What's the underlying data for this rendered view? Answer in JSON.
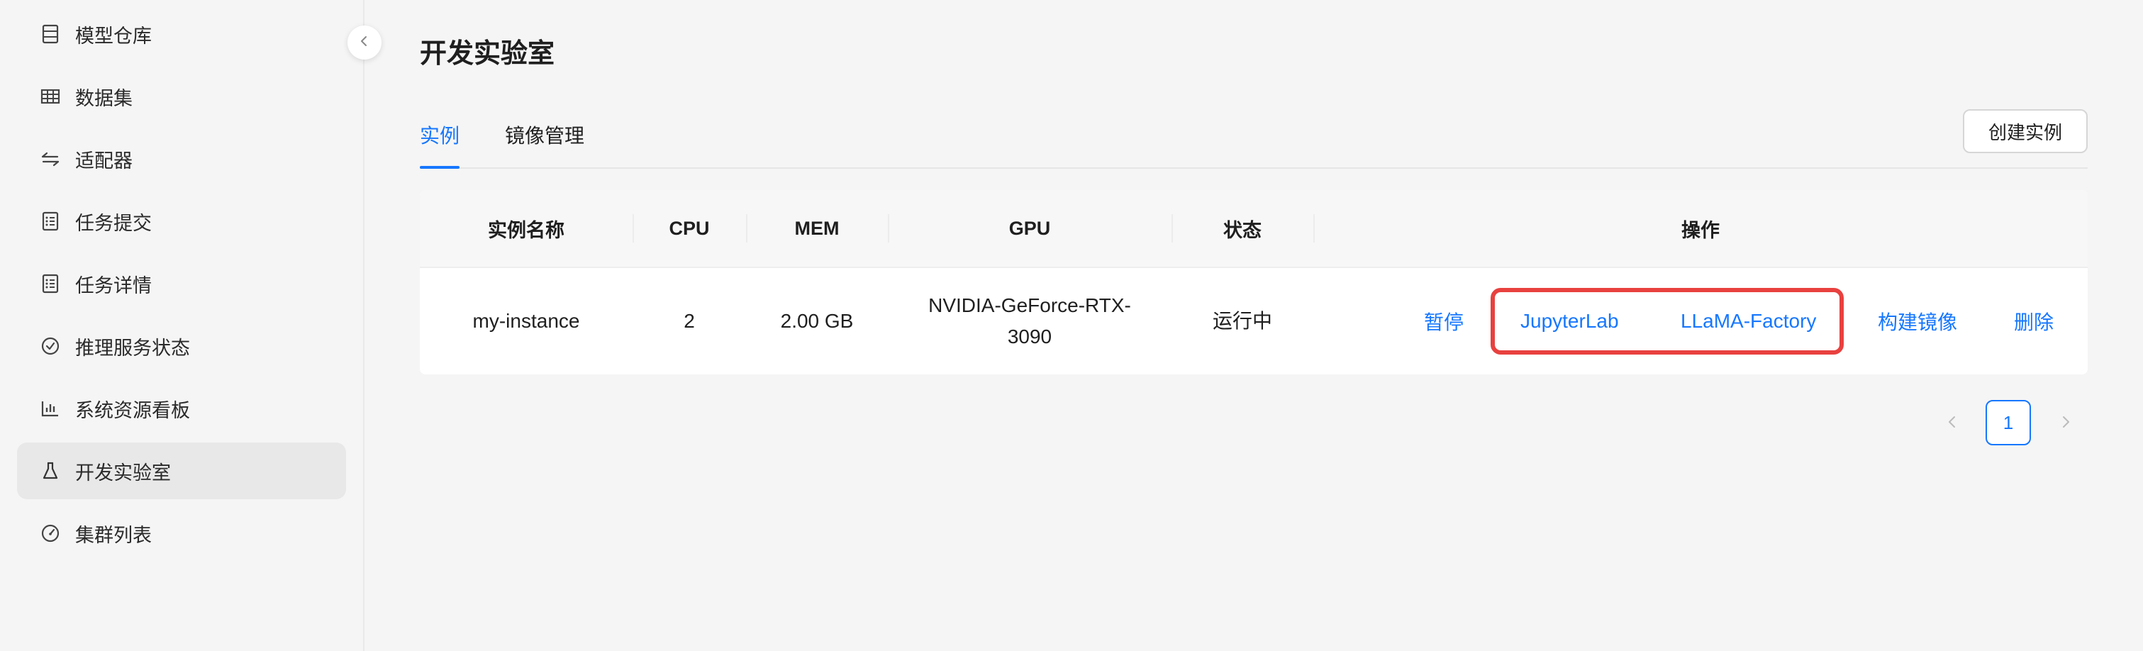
{
  "sidebar": {
    "items": [
      {
        "label": "模型仓库",
        "icon": "model-repo-icon"
      },
      {
        "label": "数据集",
        "icon": "table-grid-icon"
      },
      {
        "label": "适配器",
        "icon": "swap-arrows-icon"
      },
      {
        "label": "任务提交",
        "icon": "task-list-icon"
      },
      {
        "label": "任务详情",
        "icon": "task-detail-icon"
      },
      {
        "label": "推理服务状态",
        "icon": "check-circle-icon"
      },
      {
        "label": "系统资源看板",
        "icon": "bar-chart-icon"
      },
      {
        "label": "开发实验室",
        "icon": "flask-icon",
        "active": true
      },
      {
        "label": "集群列表",
        "icon": "dashboard-gauge-icon"
      }
    ]
  },
  "page": {
    "title": "开发实验室"
  },
  "tabs": [
    {
      "label": "实例",
      "active": true
    },
    {
      "label": "镜像管理",
      "active": false
    }
  ],
  "create_button": "创建实例",
  "table": {
    "columns": [
      "实例名称",
      "CPU",
      "MEM",
      "GPU",
      "状态",
      "操作"
    ],
    "rows": [
      {
        "name": "my-instance",
        "cpu": "2",
        "mem": "2.00 GB",
        "gpu_line1": "NVIDIA-GeForce-RTX-",
        "gpu_line2": "3090",
        "status": "运行中",
        "actions": {
          "pause": "暂停",
          "jupyter": "JupyterLab",
          "llama": "LLaMA-Factory",
          "build": "构建镜像",
          "delete": "删除"
        }
      }
    ]
  },
  "pagination": {
    "current_page": "1"
  },
  "colors": {
    "accent": "#1677ff",
    "highlight": "#e8413f"
  }
}
